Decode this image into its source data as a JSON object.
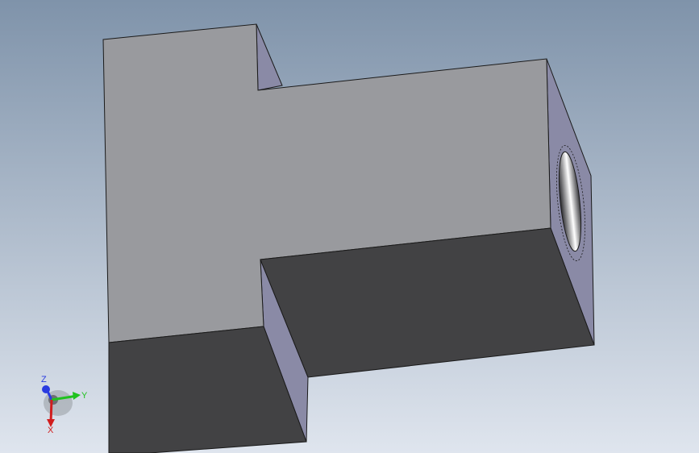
{
  "viewport": {
    "background_top": "#7f93aa",
    "background_bottom": "#dfe5ee"
  },
  "part": {
    "top_face_color": "#999a9e",
    "front_face_color": "#424244",
    "side_face_color": "#8a8aa6",
    "edge_color": "#1a1a1a",
    "hole_shading": [
      "#2b2b2f",
      "#ffffff",
      "#3a3a3e"
    ]
  },
  "triad": {
    "axes": [
      {
        "label": "Z",
        "color": "#2a3be0"
      },
      {
        "label": "Y",
        "color": "#1fc21f"
      },
      {
        "label": "X",
        "color": "#d11d1d"
      }
    ]
  }
}
